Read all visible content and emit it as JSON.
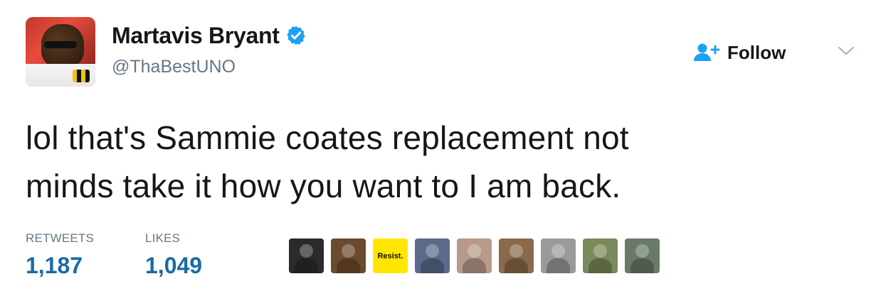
{
  "user": {
    "display_name": "Martavis Bryant",
    "handle": "@ThaBestUNO",
    "verified": true,
    "avatar_icon": "user-avatar-photo"
  },
  "header": {
    "follow_label": "Follow",
    "follow_icon": "add-user-icon",
    "menu_icon": "chevron-down-icon"
  },
  "tweet": {
    "text_line1": "lol that's Sammie coates replacement not",
    "text_line2": "minds take it how you want to I am back."
  },
  "stats": {
    "retweets_label": "RETWEETS",
    "retweets_value": "1,187",
    "likes_label": "LIKES",
    "likes_value": "1,049"
  },
  "likers": [
    {
      "icon": "liker-avatar-1",
      "bg": "#2b2b2b"
    },
    {
      "icon": "liker-avatar-2",
      "bg": "#6b4a2e"
    },
    {
      "icon": "liker-avatar-3",
      "bg": "#ffe600",
      "text": "Resist."
    },
    {
      "icon": "liker-avatar-4",
      "bg": "#5a6a8a"
    },
    {
      "icon": "liker-avatar-5",
      "bg": "#b89a8a"
    },
    {
      "icon": "liker-avatar-6",
      "bg": "#8a6a4a"
    },
    {
      "icon": "liker-avatar-7",
      "bg": "#9a9a9a"
    },
    {
      "icon": "liker-avatar-8",
      "bg": "#7a8a5a"
    },
    {
      "icon": "liker-avatar-9",
      "bg": "#6a7a6a"
    }
  ],
  "colors": {
    "accent": "#1da1f2",
    "stat_value": "#1b6aa5",
    "secondary_text": "#657786",
    "primary_text": "#14171a"
  }
}
